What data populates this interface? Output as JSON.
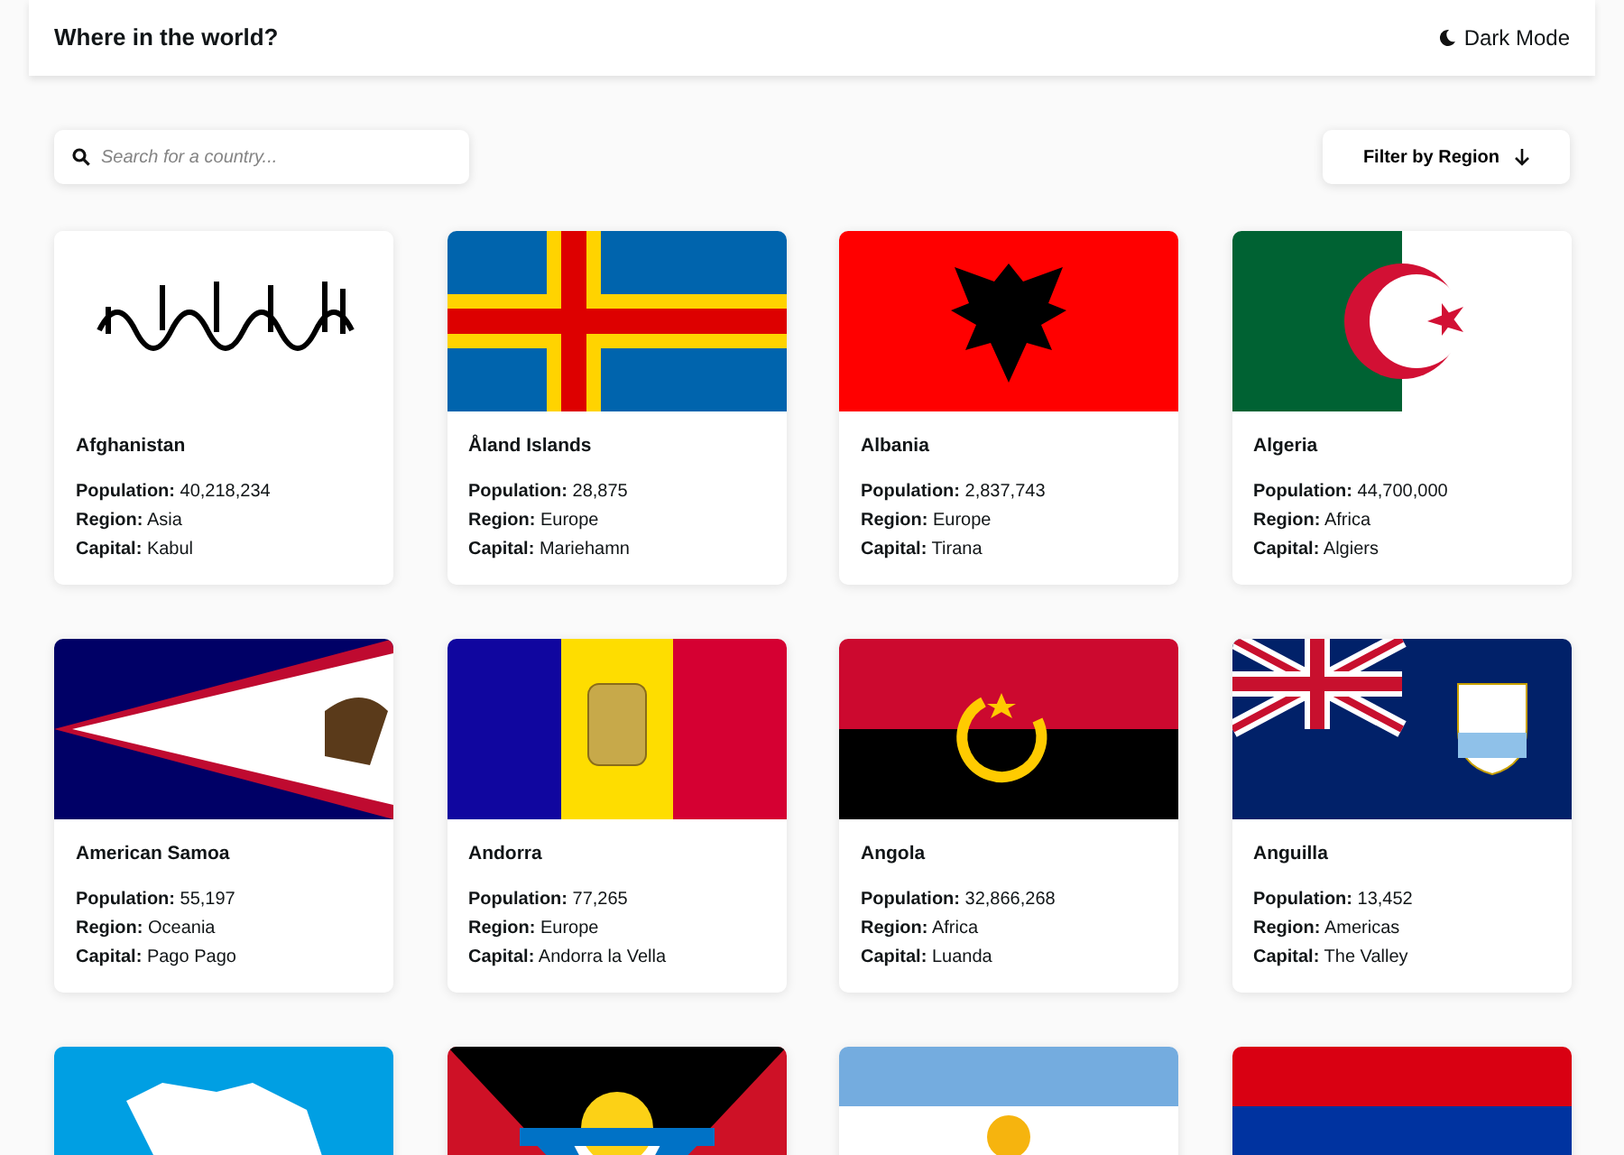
{
  "header": {
    "title": "Where in the world?",
    "theme_toggle": "Dark Mode"
  },
  "search": {
    "placeholder": "Search for a country..."
  },
  "filter": {
    "label": "Filter by Region"
  },
  "countries": [
    {
      "kind": "calligraphy",
      "name": "Afghanistan",
      "stats": [
        {
          "label": "Population:",
          "value": "40,218,234"
        },
        {
          "label": "Region:",
          "value": "Asia"
        },
        {
          "label": "Capital:",
          "value": "Kabul"
        }
      ]
    },
    {
      "kind": "aland",
      "name": "Åland Islands",
      "stats": [
        {
          "label": "Population:",
          "value": "28,875"
        },
        {
          "label": "Region:",
          "value": "Europe"
        },
        {
          "label": "Capital:",
          "value": "Mariehamn"
        }
      ]
    },
    {
      "kind": "eagle",
      "name": "Albania",
      "stats": [
        {
          "label": "Population:",
          "value": "2,837,743"
        },
        {
          "label": "Region:",
          "value": "Europe"
        },
        {
          "label": "Capital:",
          "value": "Tirana"
        }
      ]
    },
    {
      "kind": "crescent",
      "name": "Algeria",
      "stats": [
        {
          "label": "Population:",
          "value": "44,700,000"
        },
        {
          "label": "Region:",
          "value": "Africa"
        },
        {
          "label": "Capital:",
          "value": "Algiers"
        }
      ]
    },
    {
      "kind": "samoa",
      "name": "American Samoa",
      "stats": [
        {
          "label": "Population:",
          "value": "55,197"
        },
        {
          "label": "Region:",
          "value": "Oceania"
        },
        {
          "label": "Capital:",
          "value": "Pago Pago"
        }
      ]
    },
    {
      "kind": "andorra",
      "name": "Andorra",
      "stats": [
        {
          "label": "Population:",
          "value": "77,265"
        },
        {
          "label": "Region:",
          "value": "Europe"
        },
        {
          "label": "Capital:",
          "value": "Andorra la Vella"
        }
      ]
    },
    {
      "kind": "angola",
      "name": "Angola",
      "stats": [
        {
          "label": "Population:",
          "value": "32,866,268"
        },
        {
          "label": "Region:",
          "value": "Africa"
        },
        {
          "label": "Capital:",
          "value": "Luanda"
        }
      ]
    },
    {
      "kind": "anguilla",
      "name": "Anguilla",
      "stats": [
        {
          "label": "Population:",
          "value": "13,452"
        },
        {
          "label": "Region:",
          "value": "Americas"
        },
        {
          "label": "Capital:",
          "value": "The Valley"
        }
      ]
    },
    {
      "kind": "antarctica"
    },
    {
      "kind": "antigua"
    },
    {
      "kind": "argentina"
    },
    {
      "kind": "armenia"
    }
  ]
}
